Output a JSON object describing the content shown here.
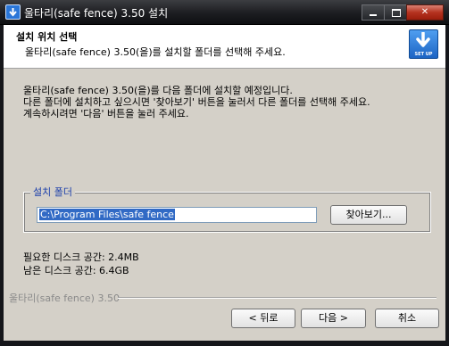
{
  "window": {
    "title": "울타리(safe fence) 3.50 설치",
    "controls": {
      "minimize": "minimize",
      "maximize": "maximize",
      "close": "✕"
    }
  },
  "header": {
    "title": "설치 위치 선택",
    "subtitle": "울타리(safe fence) 3.50(을)를 설치할 폴더를 선택해 주세요.",
    "icon_label": "SET UP"
  },
  "body": {
    "description": [
      "울타리(safe fence) 3.50(을)를 다음 폴더에 설치할 예정입니다.",
      "다른 폴더에 설치하고 싶으시면 '찾아보기' 버튼을 눌러서 다른 폴더를 선택해 주세요.",
      "계속하시려면 '다음' 버튼을 눌러 주세요."
    ],
    "group_label": "설치 폴더",
    "install_path": "C:\\Program Files\\safe fence",
    "browse_label": "찾아보기...",
    "required_space": "필요한 디스크 공간: 2.4MB",
    "available_space": "남은 디스크 공간: 6.4GB"
  },
  "footer": {
    "brand": "울타리(safe fence) 3.50",
    "back_label": "< 뒤로",
    "next_label": "다음 >",
    "cancel_label": "취소"
  },
  "colors": {
    "title_bar": "#1c1d21",
    "body_bg": "#d4d0c8",
    "selection": "#316ac5",
    "group_label": "#1c3faa"
  }
}
